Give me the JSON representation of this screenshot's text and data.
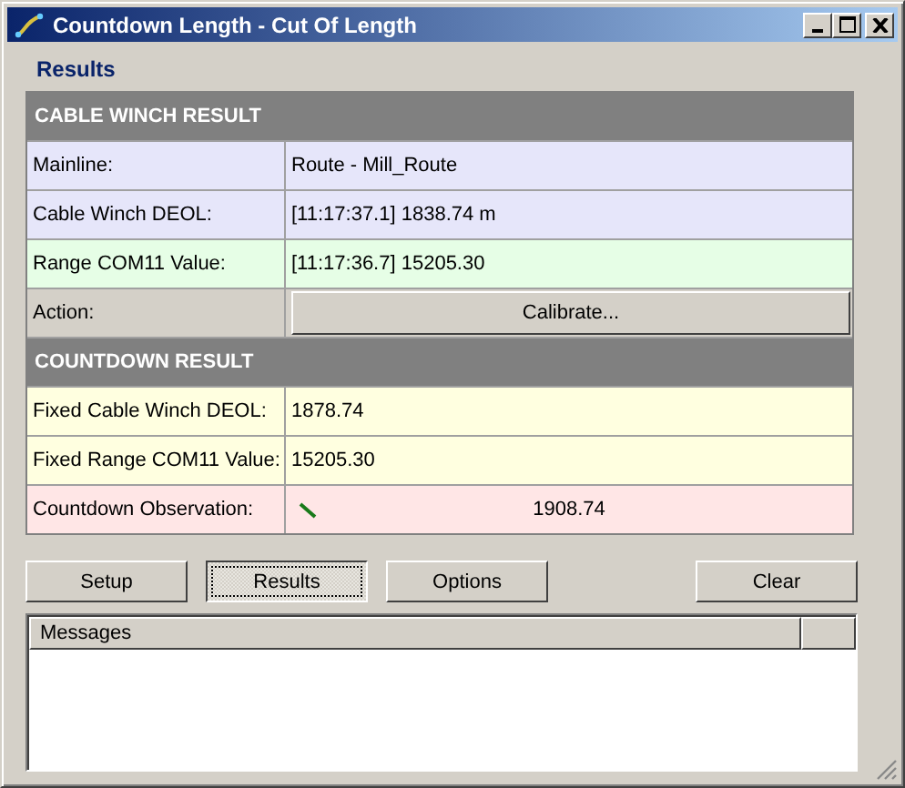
{
  "window": {
    "title": "Countdown Length - Cut Of Length"
  },
  "section_title": "Results",
  "groups": [
    {
      "title": "CABLE WINCH RESULT",
      "rows": [
        {
          "kind": "text",
          "label": "Mainline:",
          "value": "Route - Mill_Route",
          "color": "#e6e6fa"
        },
        {
          "kind": "text",
          "label": "Cable Winch DEOL:",
          "value": "[11:17:37.1] 1838.74 m",
          "color": "#e6e6fa"
        },
        {
          "kind": "text",
          "label": "Range COM11 Value:",
          "value": "[11:17:36.7] 15205.30",
          "color": "#e6fee6"
        },
        {
          "kind": "button",
          "label": "Action:",
          "value": "Calibrate...",
          "color": "#d4d0c8"
        }
      ]
    },
    {
      "title": "COUNTDOWN RESULT",
      "rows": [
        {
          "kind": "text",
          "label": "Fixed Cable Winch DEOL:",
          "value": "1878.74",
          "color": "#ffffe0"
        },
        {
          "kind": "text",
          "label": "Fixed Range COM11 Value:",
          "value": "15205.30",
          "color": "#ffffe0"
        },
        {
          "kind": "observation",
          "label": "Countdown Observation:",
          "value": "1908.74",
          "color": "#ffe6e6"
        }
      ]
    }
  ],
  "buttons": [
    {
      "label": "Setup",
      "selected": false
    },
    {
      "label": "Results",
      "selected": true
    },
    {
      "label": "Options",
      "selected": false
    },
    {
      "label": "Clear",
      "selected": false
    }
  ],
  "messages": {
    "columns": [
      "Messages"
    ]
  }
}
